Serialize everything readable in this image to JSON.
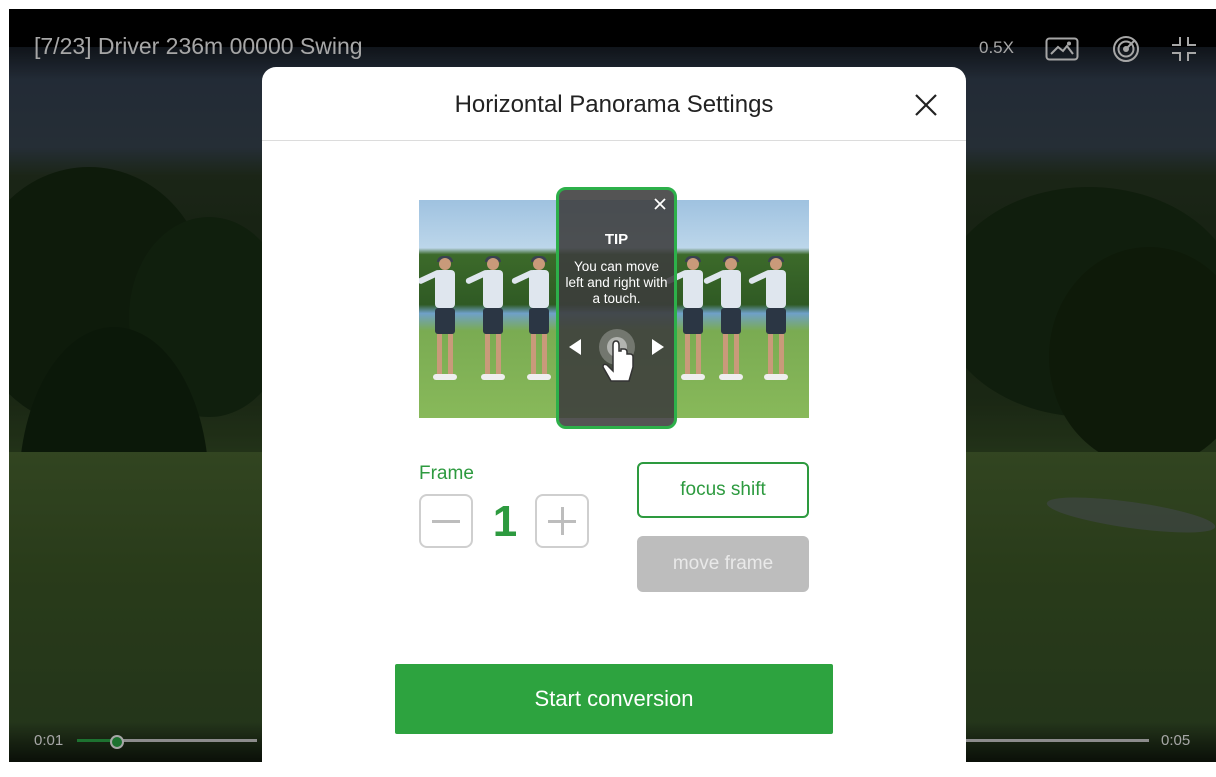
{
  "player": {
    "title": "[7/23] Driver 236m 00000 Swing",
    "speed": "0.5X",
    "time_current": "0:01",
    "time_total": "0:05",
    "progress_fraction": 0.13,
    "icons": [
      "panorama-image-icon",
      "target-icon",
      "exit-fullscreen-icon"
    ]
  },
  "modal": {
    "title": "Horizontal Panorama Settings",
    "tip": {
      "title": "TIP",
      "text": "You can move left and right with a touch."
    },
    "frame": {
      "label": "Frame",
      "value": "1"
    },
    "focus_shift_label": "focus shift",
    "move_frame_label": "move frame",
    "start_label": "Start conversion"
  },
  "colors": {
    "accent": "#2da33f",
    "disabled": "#bdbdbd"
  }
}
